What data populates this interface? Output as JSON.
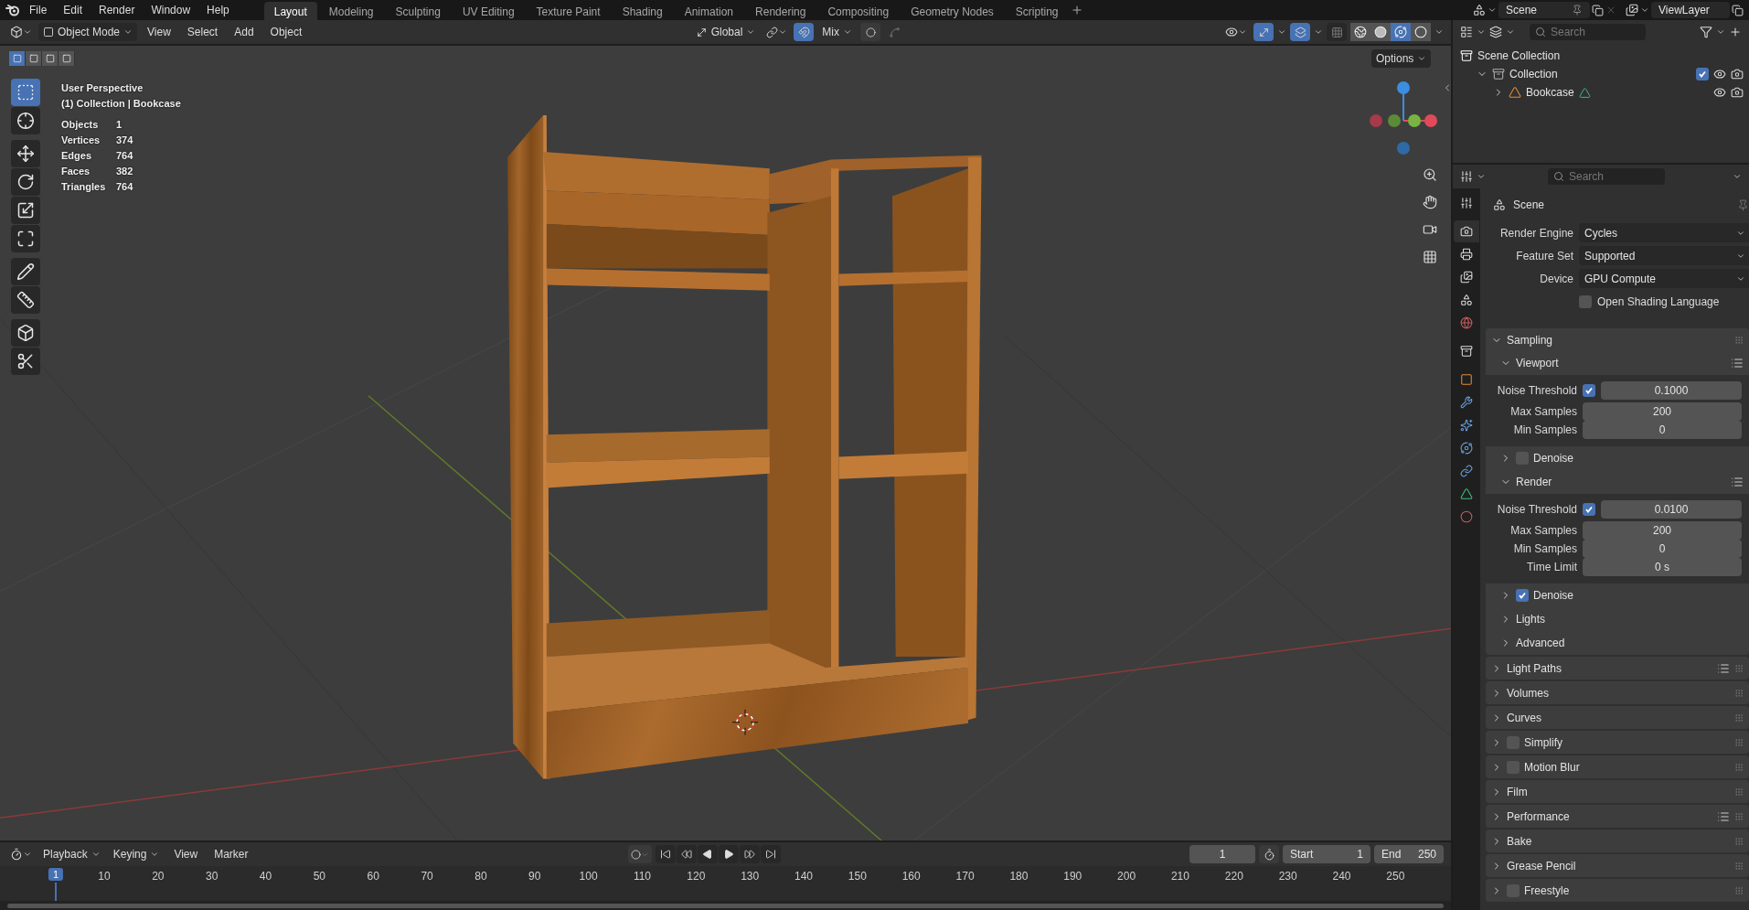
{
  "menu": [
    "File",
    "Edit",
    "Render",
    "Window",
    "Help"
  ],
  "workspaces": [
    {
      "label": "Layout",
      "selected": true
    },
    {
      "label": "Modeling",
      "selected": false
    },
    {
      "label": "Sculpting",
      "selected": false
    },
    {
      "label": "UV Editing",
      "selected": false
    },
    {
      "label": "Texture Paint",
      "selected": false
    },
    {
      "label": "Shading",
      "selected": false
    },
    {
      "label": "Animation",
      "selected": false
    },
    {
      "label": "Rendering",
      "selected": false
    },
    {
      "label": "Compositing",
      "selected": false
    },
    {
      "label": "Geometry Nodes",
      "selected": false
    },
    {
      "label": "Scripting",
      "selected": false
    }
  ],
  "scene": "Scene",
  "view_layer": "ViewLayer",
  "viewport": {
    "mode": "Object Mode",
    "menus": [
      "View",
      "Select",
      "Add",
      "Object"
    ],
    "orientation": "Global",
    "snap": {
      "on": true
    },
    "snap_target": "Mix",
    "proportional": {
      "on": false
    },
    "gizmos": {
      "on": true
    },
    "overlays": {
      "on": true
    },
    "shading": [
      {
        "kind": "wireframe",
        "selected": false
      },
      {
        "kind": "solid",
        "selected": false
      },
      {
        "kind": "material",
        "selected": true
      },
      {
        "kind": "rendered",
        "selected": false
      }
    ],
    "select_modes": [
      {
        "selected": true
      },
      {
        "selected": false
      },
      {
        "selected": false
      },
      {
        "selected": false
      }
    ],
    "options": "Options",
    "tools": [
      {
        "kind": "select",
        "selected": true
      },
      {
        "kind": "cursor",
        "selected": false
      },
      {
        "kind": "move",
        "selected": false
      },
      {
        "kind": "rotate",
        "selected": false
      },
      {
        "kind": "scale",
        "selected": false
      },
      {
        "kind": "transform",
        "selected": false
      },
      {
        "kind": "annotate",
        "selected": false
      },
      {
        "kind": "measure",
        "selected": false
      },
      {
        "kind": "add-cube",
        "selected": false
      },
      {
        "kind": "shear",
        "selected": false
      }
    ],
    "title": "User Perspective",
    "context": "(1) Collection | Bookcase",
    "stats": [
      {
        "label": "Objects",
        "value": "1"
      },
      {
        "label": "Vertices",
        "value": "374"
      },
      {
        "label": "Edges",
        "value": "764"
      },
      {
        "label": "Faces",
        "value": "382"
      },
      {
        "label": "Triangles",
        "value": "764"
      }
    ]
  },
  "outliner": {
    "placeholder": "Search",
    "tree": [
      {
        "label": "Scene Collection",
        "kind": "scene-collection",
        "children": [
          {
            "label": "Collection",
            "kind": "collection",
            "expanded": true,
            "checked": true,
            "children": [
              {
                "label": "Bookcase",
                "kind": "mesh",
                "expanded": false
              }
            ]
          }
        ]
      }
    ]
  },
  "properties": {
    "placeholder": "Search",
    "context": "Scene",
    "tabs": [
      {
        "kind": "tool",
        "selected": false
      },
      {
        "kind": "render",
        "selected": true
      },
      {
        "kind": "output",
        "selected": false
      },
      {
        "kind": "view-layer",
        "selected": false
      },
      {
        "kind": "scene",
        "selected": false
      },
      {
        "kind": "world",
        "selected": false
      },
      {
        "kind": "collection",
        "selected": false
      },
      {
        "kind": "object",
        "selected": false
      },
      {
        "kind": "modifiers",
        "selected": false
      },
      {
        "kind": "particles",
        "selected": false
      },
      {
        "kind": "physics",
        "selected": false
      },
      {
        "kind": "constraints",
        "selected": false
      },
      {
        "kind": "data",
        "selected": false
      },
      {
        "kind": "material",
        "selected": false
      }
    ],
    "fields": [
      {
        "label": "Render Engine",
        "value": "Cycles"
      },
      {
        "label": "Feature Set",
        "value": "Supported"
      },
      {
        "label": "Device",
        "value": "GPU Compute"
      }
    ],
    "osl": {
      "label": "Open Shading Language",
      "checked": false
    },
    "panels": [
      {
        "title": "Sampling",
        "expanded": true,
        "children": [
          {
            "title": "Viewport",
            "expanded": true,
            "presets": true,
            "rows": [
              {
                "label": "Noise Threshold",
                "value": "0.1000",
                "checked": true
              },
              {
                "label": "Max Samples",
                "value": "200"
              },
              {
                "label": "Min Samples",
                "value": "0"
              }
            ],
            "children": [
              {
                "title": "Denoise",
                "expanded": false,
                "checkbox": false
              }
            ]
          },
          {
            "title": "Render",
            "expanded": true,
            "presets": true,
            "rows": [
              {
                "label": "Noise Threshold",
                "value": "0.0100",
                "checked": true
              },
              {
                "label": "Max Samples",
                "value": "200"
              },
              {
                "label": "Min Samples",
                "value": "0"
              },
              {
                "label": "Time Limit",
                "value": "0 s"
              }
            ],
            "children": [
              {
                "title": "Denoise",
                "expanded": false,
                "checkbox": true
              },
              {
                "title": "Lights",
                "expanded": false
              },
              {
                "title": "Advanced",
                "expanded": false
              }
            ]
          }
        ]
      },
      {
        "title": "Light Paths",
        "expanded": false,
        "presets": true
      },
      {
        "title": "Volumes",
        "expanded": false
      },
      {
        "title": "Curves",
        "expanded": false
      },
      {
        "title": "Simplify",
        "expanded": false,
        "checkbox": false
      },
      {
        "title": "Motion Blur",
        "expanded": false,
        "checkbox": false
      },
      {
        "title": "Film",
        "expanded": false
      },
      {
        "title": "Performance",
        "expanded": false,
        "presets": true
      },
      {
        "title": "Bake",
        "expanded": false
      },
      {
        "title": "Grease Pencil",
        "expanded": false
      },
      {
        "title": "Freestyle",
        "expanded": false,
        "checkbox": false
      }
    ]
  },
  "timeline": {
    "menus": [
      "Playback",
      "Keying",
      "View",
      "Marker"
    ],
    "auto_key": {
      "on": false
    },
    "current_frame": "1",
    "start_label": "Start",
    "start": "1",
    "end_label": "End",
    "end": "250",
    "playhead": "1",
    "ruler": [
      "10",
      "20",
      "30",
      "40",
      "50",
      "60",
      "70",
      "80",
      "90",
      "100",
      "110",
      "120",
      "130",
      "140",
      "150",
      "160",
      "170",
      "180",
      "190",
      "200",
      "210",
      "220",
      "230",
      "240",
      "250"
    ]
  }
}
